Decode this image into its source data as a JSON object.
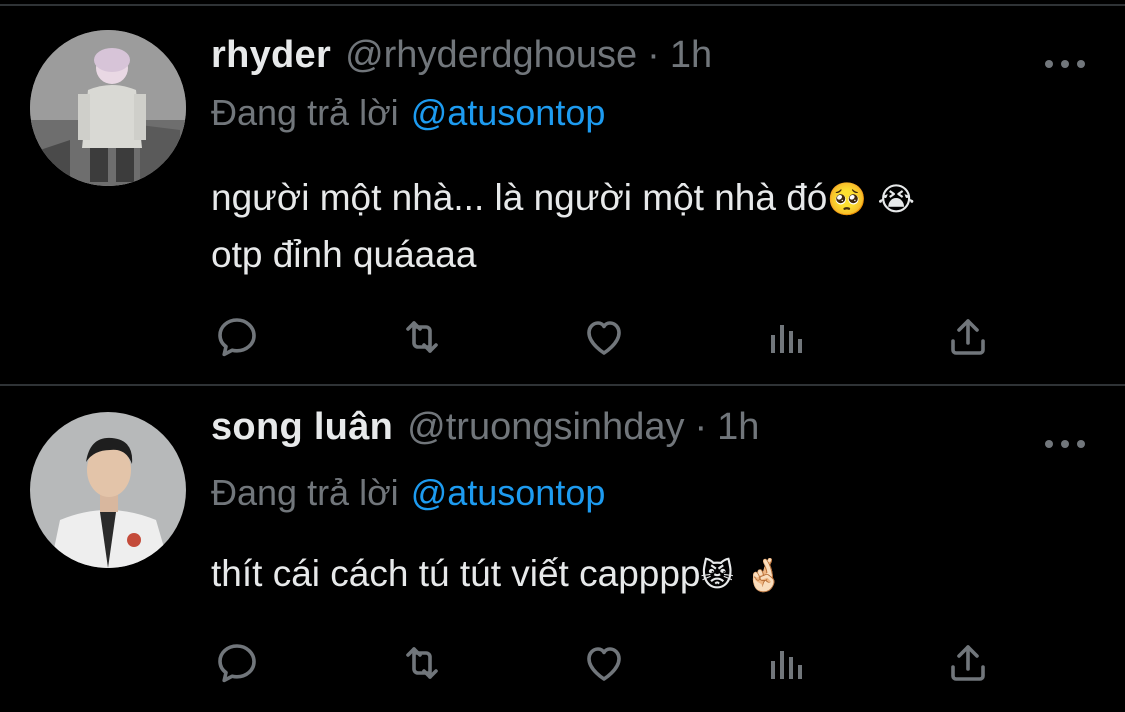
{
  "colors": {
    "background": "#000000",
    "text": "#e7e9ea",
    "secondary": "#71767b",
    "accent": "#1d9bf0",
    "divider": "#2f3336"
  },
  "tweets": [
    {
      "name": "rhyder",
      "handle": "@rhyderdghouse",
      "separator": "·",
      "time": "1h",
      "reply_prefix": "Đang trả lời",
      "reply_to": "@atusontop",
      "text_line1": "người một nhà... là người một nhà đó",
      "emoji1": "🥺",
      "emoji2": "😭",
      "text_line2": "otp đỉnh quáaaa",
      "avatar_icon": "person-avatar-light-hoodie"
    },
    {
      "name": "song luân",
      "handle": "@truongsinhday",
      "separator": "·",
      "time": "1h",
      "reply_prefix": "Đang trả lời",
      "reply_to": "@atusontop",
      "text_line1": "thít cái cách tú tút viết capppp",
      "emoji1": "😾",
      "emoji2": "🤞🏻",
      "avatar_icon": "person-avatar-white-shirt"
    }
  ],
  "action_icons": [
    "reply-icon",
    "retweet-icon",
    "like-icon",
    "views-icon",
    "share-icon"
  ]
}
